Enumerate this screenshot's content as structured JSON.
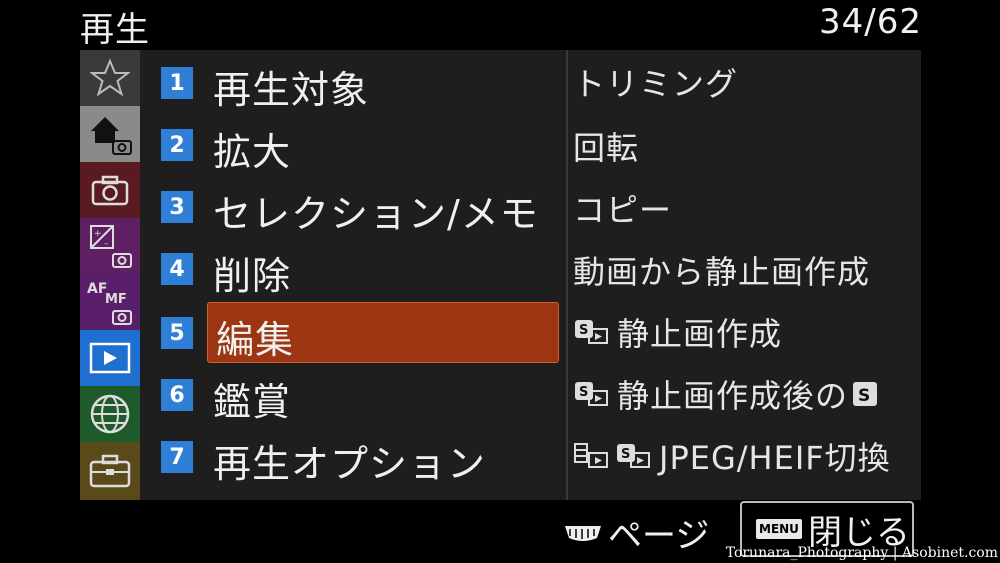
{
  "header": {
    "title": "再生",
    "page_counter": "34/62"
  },
  "sidebar": {
    "tabs": [
      {
        "icon": "star-icon",
        "color": "#3a3a3a"
      },
      {
        "icon": "home-camera-icon",
        "color": "#8a8a8a"
      },
      {
        "icon": "camera-icon",
        "color": "#5a1a22"
      },
      {
        "icon": "exposure-camera-icon",
        "color": "#5e1f63"
      },
      {
        "icon": "af-mf-camera-icon",
        "color": "#5a1f6b"
      },
      {
        "icon": "playback-icon",
        "color": "#1f6fd0"
      },
      {
        "icon": "globe-icon",
        "color": "#1f5a2a"
      },
      {
        "icon": "toolbox-icon",
        "color": "#5a4a1a"
      }
    ]
  },
  "menu": {
    "items": [
      {
        "num": "1",
        "label": "再生対象"
      },
      {
        "num": "2",
        "label": "拡大"
      },
      {
        "num": "3",
        "label": "セレクション/メモ"
      },
      {
        "num": "4",
        "label": "削除"
      },
      {
        "num": "5",
        "label": "編集"
      },
      {
        "num": "6",
        "label": "鑑賞"
      },
      {
        "num": "7",
        "label": "再生オプション"
      }
    ],
    "selected_color": "#9b3512"
  },
  "submenu": {
    "items": [
      {
        "label": "トリミング"
      },
      {
        "label": "回転"
      },
      {
        "label": "コピー"
      },
      {
        "label": "動画から静止画作成"
      },
      {
        "label": "静止画作成"
      },
      {
        "label": "静止画作成後の"
      },
      {
        "label": "JPEG/HEIF切換"
      }
    ]
  },
  "footer": {
    "page_label": "ページ",
    "menu_badge": "MENU",
    "close_label": "閉じる"
  },
  "watermark": "Torunara_Photography | Asobinet.com"
}
